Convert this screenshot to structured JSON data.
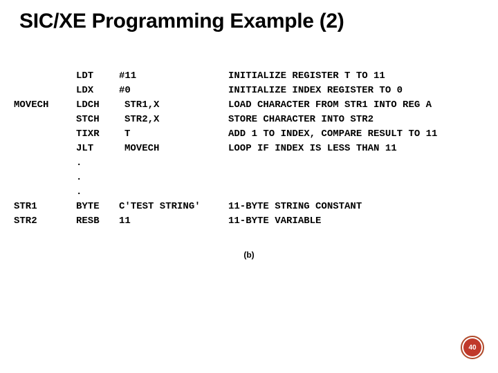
{
  "title": "SIC/XE Programming Example (2)",
  "caption": "(b)",
  "page_number": "40",
  "code_rows": [
    {
      "label": "",
      "opcode": "LDT",
      "operand": "#11",
      "operand_indent": false,
      "comment": "INITIALIZE REGISTER T TO 11"
    },
    {
      "label": "",
      "opcode": "LDX",
      "operand": "#0",
      "operand_indent": false,
      "comment": "INITIALIZE INDEX REGISTER TO 0"
    },
    {
      "label": "MOVECH",
      "opcode": "LDCH",
      "operand": "STR1,X",
      "operand_indent": true,
      "comment": "LOAD CHARACTER FROM STR1 INTO REG A"
    },
    {
      "label": "",
      "opcode": "STCH",
      "operand": "STR2,X",
      "operand_indent": true,
      "comment": "STORE CHARACTER INTO STR2"
    },
    {
      "label": "",
      "opcode": "TIXR",
      "operand": "T",
      "operand_indent": true,
      "comment": "ADD 1 TO INDEX, COMPARE RESULT TO 11"
    },
    {
      "label": "",
      "opcode": "JLT",
      "operand": "MOVECH",
      "operand_indent": true,
      "comment": "LOOP IF INDEX IS LESS THAN 11"
    },
    {
      "label": "",
      "opcode": ".",
      "operand": "",
      "operand_indent": false,
      "comment": ""
    },
    {
      "label": "",
      "opcode": ".",
      "operand": "",
      "operand_indent": false,
      "comment": ""
    },
    {
      "label": "",
      "opcode": ".",
      "operand": "",
      "operand_indent": false,
      "comment": ""
    },
    {
      "label": "STR1",
      "opcode": "BYTE",
      "operand": "C'TEST STRING'",
      "operand_indent": false,
      "comment": "11-BYTE STRING CONSTANT"
    },
    {
      "label": "STR2",
      "opcode": "RESB",
      "operand": "11",
      "operand_indent": false,
      "comment": "11-BYTE VARIABLE"
    }
  ]
}
